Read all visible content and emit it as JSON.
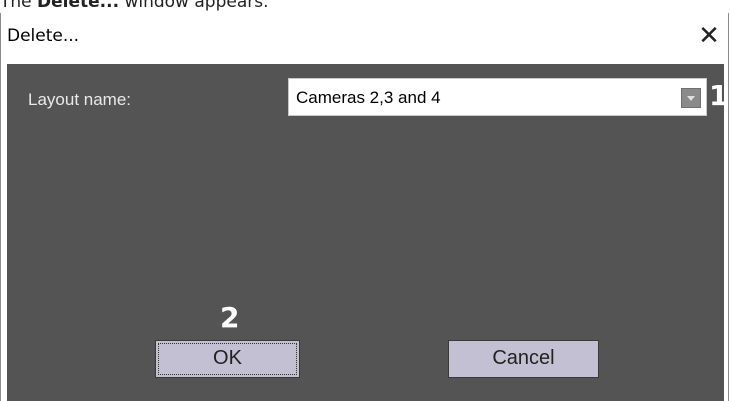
{
  "doc": {
    "text_prefix": "The ",
    "text_bold": "Delete...",
    "text_suffix": " window appears."
  },
  "dialog": {
    "title": "Delete...",
    "close_glyph": "✕",
    "layout_label": "Layout name:",
    "layout_value": "Cameras 2,3 and 4",
    "ok_label": "OK",
    "cancel_label": "Cancel"
  },
  "annotations": {
    "marker_1": "1",
    "marker_2": "2"
  },
  "colors": {
    "client_background": "#545454",
    "button_background": "#c3c0d3",
    "label_text": "#e9e9e9"
  }
}
